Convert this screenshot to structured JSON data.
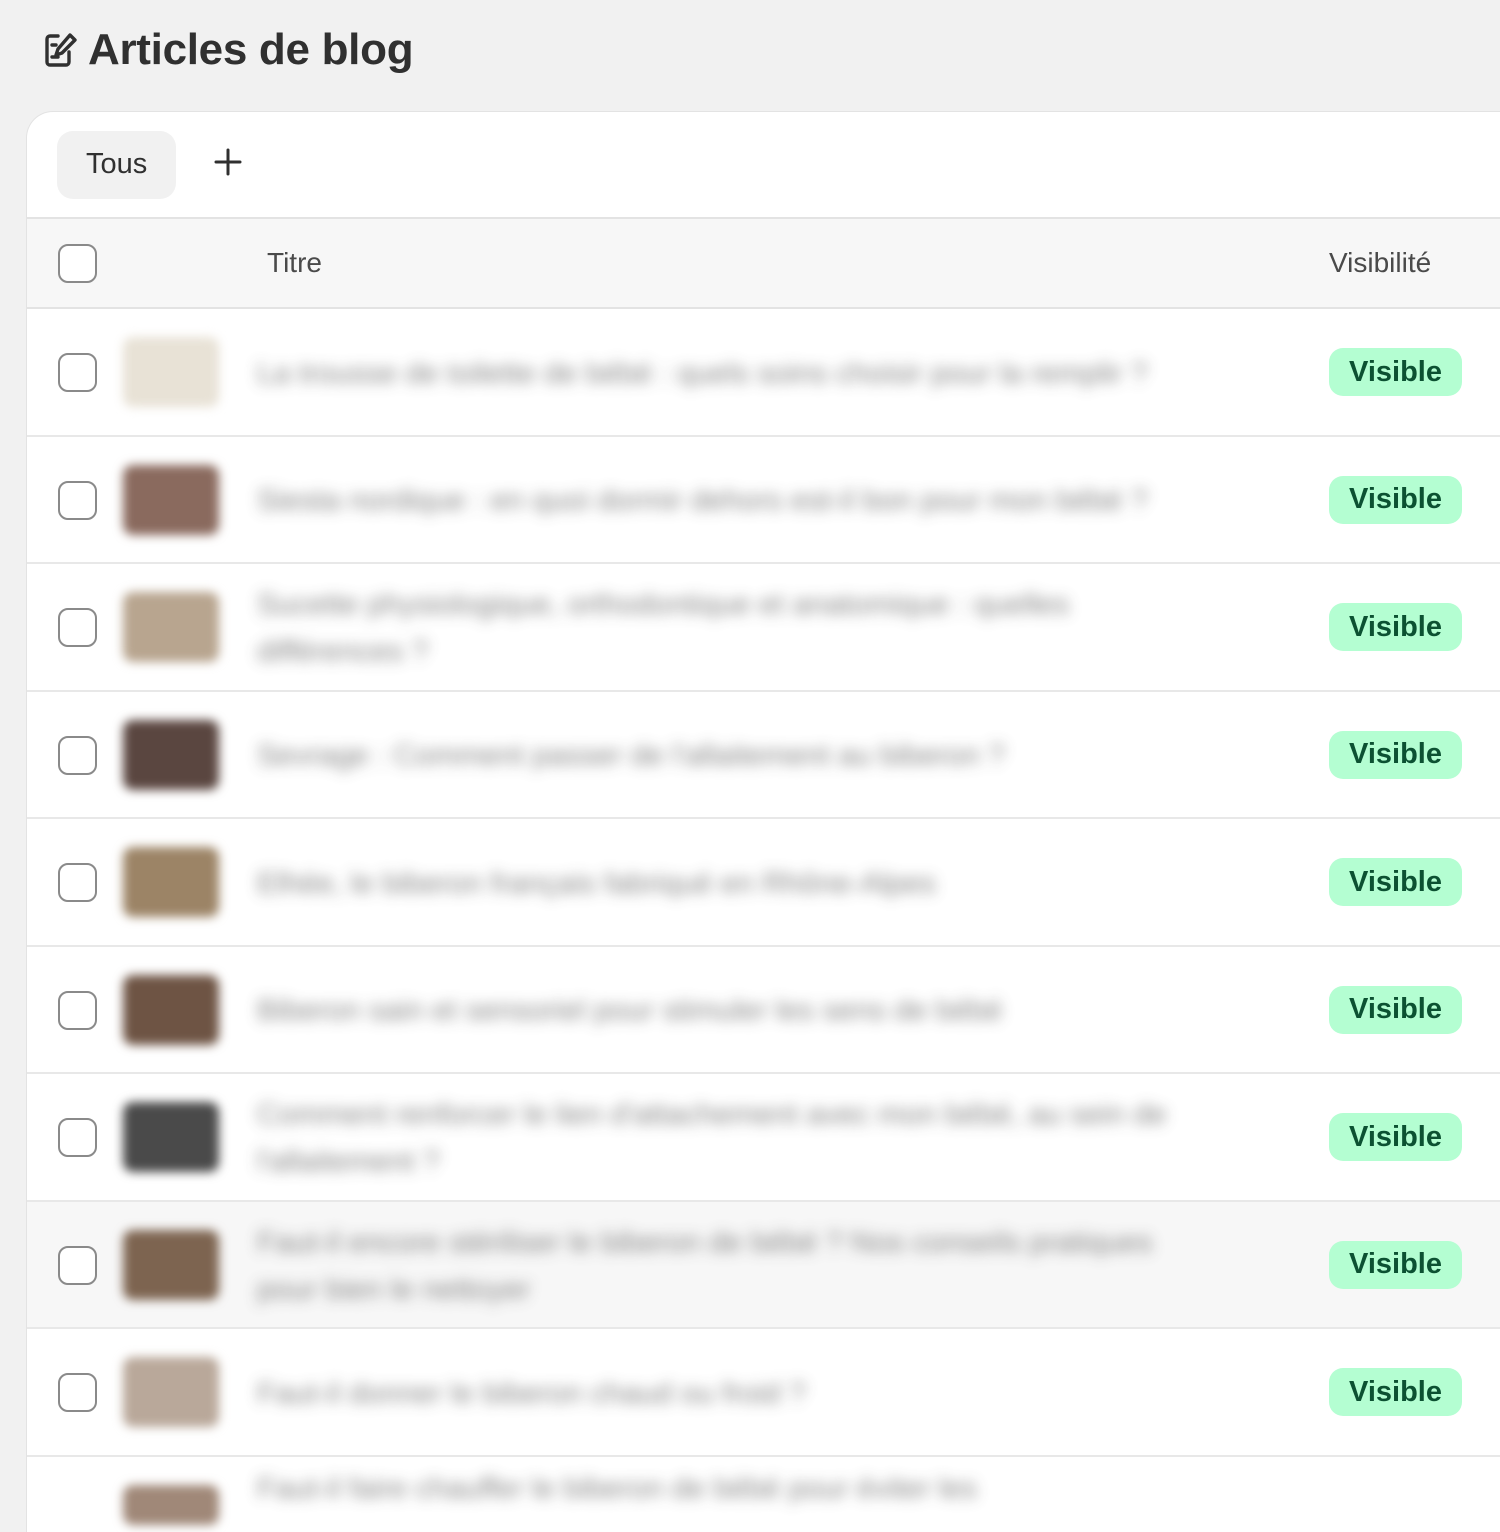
{
  "page": {
    "title": "Articles de blog",
    "icon": "edit-document-icon"
  },
  "tabs": [
    {
      "label": "Tous",
      "selected": true
    }
  ],
  "add_tab_icon": "plus-icon",
  "table": {
    "columns": {
      "title": "Titre",
      "visibility": "Visibilité"
    },
    "rows": [
      {
        "title": "La trousse de toilette de bébé : quels soins choisir pour la remplir ?",
        "visibility": "Visible",
        "thumb_color": "#e8e2d6"
      },
      {
        "title": "Siesta nordique : en quoi dormir dehors est-il bon pour mon bébé ?",
        "visibility": "Visible",
        "thumb_color": "#8a6a5e"
      },
      {
        "title": "Sucette physiologique, orthodontique et anatomique : quelles différences ?",
        "visibility": "Visible",
        "thumb_color": "#b8a58f"
      },
      {
        "title": "Sevrage : Comment passer de l'allaitement au biberon ?",
        "visibility": "Visible",
        "thumb_color": "#5a4640"
      },
      {
        "title": "Elhée, le biberon français fabriqué en Rhône-Alpes",
        "visibility": "Visible",
        "thumb_color": "#9c8466"
      },
      {
        "title": "Biberon sain et sensoriel pour stimuler les sens de bébé",
        "visibility": "Visible",
        "thumb_color": "#6e5444"
      },
      {
        "title": "Comment renforcer le lien d'attachement avec mon bébé, au sein de l'allaitement ?",
        "visibility": "Visible",
        "thumb_color": "#4a4a4a"
      },
      {
        "title": "Faut-il encore stériliser le biberon de bébé ? Nos conseils pratiques pour bien le nettoyer",
        "visibility": "Visible",
        "thumb_color": "#7d6450"
      },
      {
        "title": "Faut-il donner le biberon chaud ou froid ?",
        "visibility": "Visible",
        "thumb_color": "#b9a89a"
      }
    ],
    "partial_row": {
      "title": "Faut-il faire chauffer le biberon de bébé pour éviter les",
      "thumb_color": "#a08878"
    }
  },
  "colors": {
    "background": "#f1f1f1",
    "badge_bg": "#b4fed2",
    "badge_text": "#0c5132"
  }
}
